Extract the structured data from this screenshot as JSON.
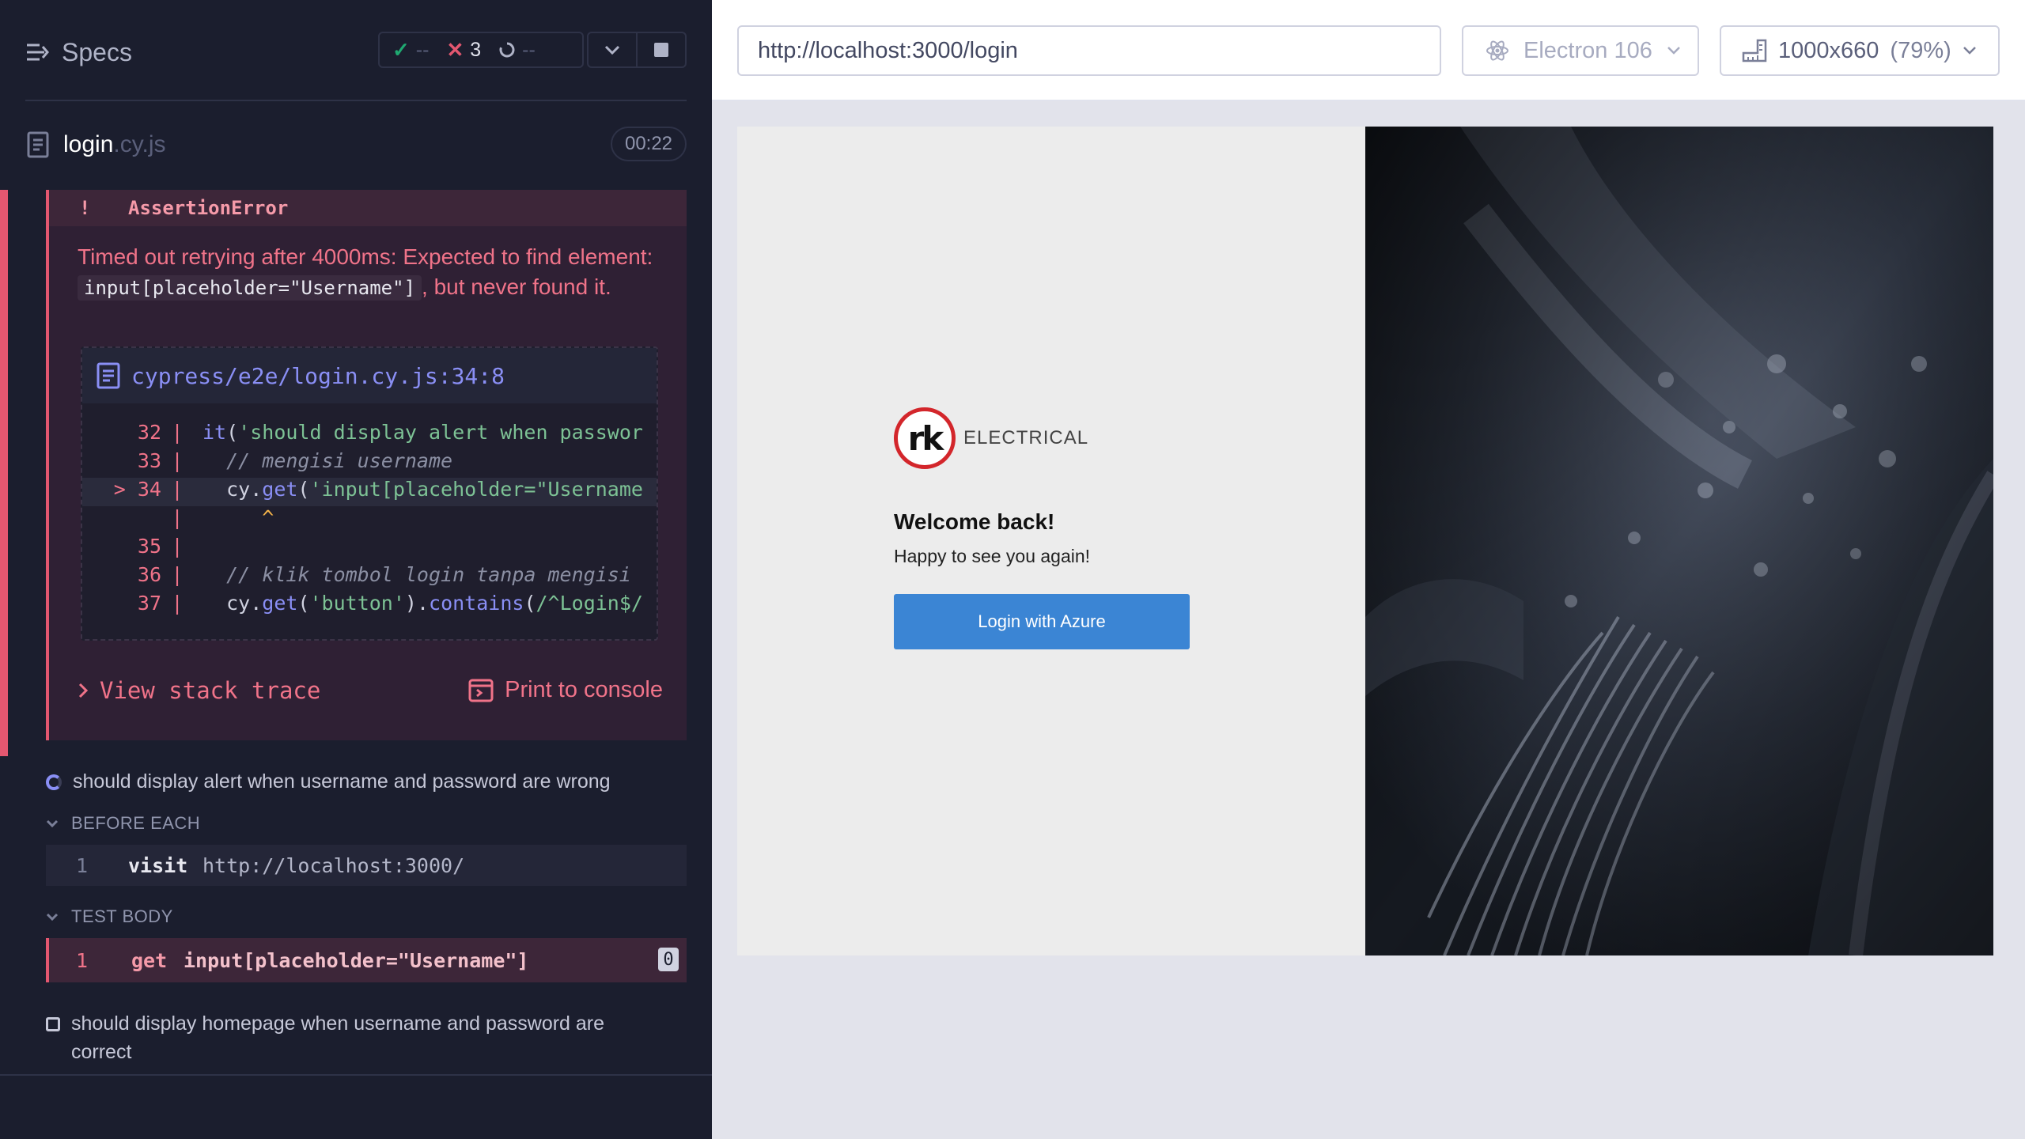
{
  "reporter": {
    "specs_label": "Specs",
    "stats": {
      "passed": "--",
      "failed": "3",
      "pending": "--"
    },
    "file": {
      "name": "login",
      "ext": ".cy.js",
      "duration": "00:22"
    },
    "error": {
      "type": "AssertionError",
      "bang": "!",
      "message_before": "Timed out retrying after 4000ms: Expected to find element: ",
      "message_code": "input[placeholder=\"Username\"]",
      "message_after": ", but never found it.",
      "file_path": "cypress/e2e/login.cy.js:34:8",
      "code_lines": [
        {
          "num": "32",
          "marker": "",
          "active": false,
          "html": "<span class=\"kw\">it</span>(<span class=\"str\">'should display alert when passwor</span>"
        },
        {
          "num": "33",
          "marker": "",
          "active": false,
          "html": "  <span class=\"cmt\">// mengisi username</span>"
        },
        {
          "num": "34",
          "marker": ">",
          "active": true,
          "html": "  cy.<span class=\"kw\">get</span>(<span class=\"str\">'input[placeholder=\"Username</span>"
        },
        {
          "num": "",
          "marker": "",
          "active": false,
          "html": "     <span class=\"caret\">^</span>"
        },
        {
          "num": "35",
          "marker": "",
          "active": false,
          "html": ""
        },
        {
          "num": "36",
          "marker": "",
          "active": false,
          "html": "  <span class=\"cmt\">// klik tombol login tanpa mengisi</span>"
        },
        {
          "num": "37",
          "marker": "",
          "active": false,
          "html": "  cy.<span class=\"kw\">get</span>(<span class=\"str\">'button'</span>).<span class=\"kw\">contains</span>(<span class=\"str\">/^Login$/</span>"
        }
      ],
      "view_stack_label": "View stack trace",
      "print_label": "Print to console"
    },
    "tests": [
      {
        "title": "should display alert when username and password are wrong",
        "before_each_label": "BEFORE EACH",
        "before_each": {
          "index": "1",
          "command": "visit",
          "arg": "http://localhost:3000/"
        },
        "test_body_label": "TEST BODY",
        "body": {
          "index": "1",
          "command": "get",
          "arg": "input[placeholder=\"Username\"]",
          "count": "0"
        }
      },
      {
        "title": "should display homepage when username and password are correct"
      }
    ]
  },
  "topbar": {
    "url": "http://localhost:3000/login",
    "browser": "Electron 106",
    "viewport": "1000x660",
    "viewport_scale": "(79%)"
  },
  "app": {
    "logo_letters": "rk",
    "logo_text": "ELECTRICAL",
    "welcome": "Welcome back!",
    "subtitle": "Happy to see you again!",
    "login_button": "Login with Azure"
  },
  "colors": {
    "accent": "#8a8ff5",
    "fail": "#e45770",
    "pass": "#1fa971",
    "azure_button": "#3b85d4",
    "logo_red": "#d3262b"
  }
}
